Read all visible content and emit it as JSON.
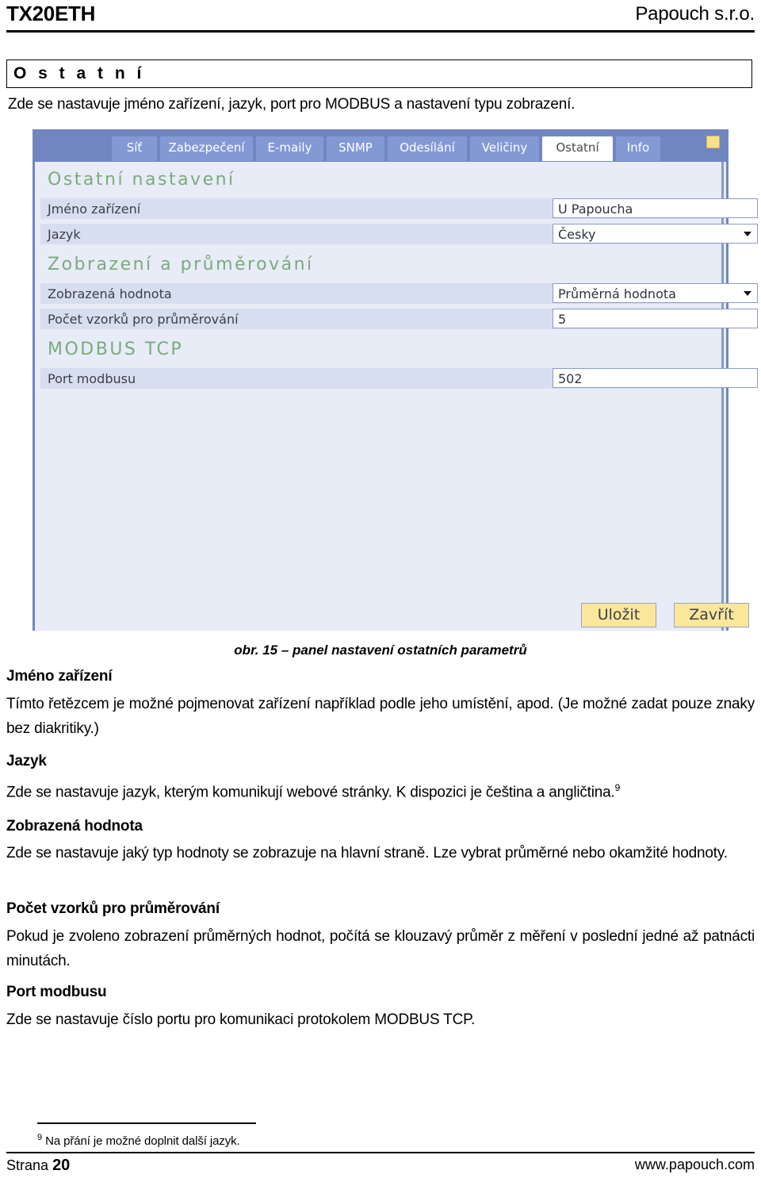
{
  "header": {
    "product": "TX20ETH",
    "company": "Papouch s.r.o."
  },
  "section": {
    "title": "O s t a t n í",
    "intro": "Zde se nastavuje jméno zařízení, jazyk, port pro MODBUS a nastavení typu zobrazení."
  },
  "screenshot": {
    "tabs": [
      {
        "label": "Síť",
        "active": false
      },
      {
        "label": "Zabezpečení",
        "active": false
      },
      {
        "label": "E-maily",
        "active": false
      },
      {
        "label": "SNMP",
        "active": false
      },
      {
        "label": "Odesílání",
        "active": false
      },
      {
        "label": "Veličiny",
        "active": false
      },
      {
        "label": "Ostatní",
        "active": true
      },
      {
        "label": "Info",
        "active": false
      }
    ],
    "groups": [
      {
        "heading": "Ostatní nastavení"
      },
      {
        "heading": "Zobrazení a průměrování"
      },
      {
        "heading": "MODBUS TCP"
      }
    ],
    "rows": [
      {
        "label": "Jméno zařízení",
        "value": "U Papoucha",
        "type": "text"
      },
      {
        "label": "Jazyk",
        "value": "Česky",
        "type": "select"
      },
      {
        "label": "Zobrazená hodnota",
        "value": "Průměrná hodnota",
        "type": "select"
      },
      {
        "label": "Počet vzorků pro průměrování",
        "value": "5",
        "type": "text"
      },
      {
        "label": "Port modbusu",
        "value": "502",
        "type": "text"
      }
    ],
    "buttons": {
      "save": "Uložit",
      "close": "Zavřít"
    },
    "colors": {
      "tabbar": "#7186c0",
      "tab": "#8399d4",
      "panel_bg": "#e8ecf7",
      "row_bg": "#d7deef",
      "group_heading": "#7aab7c",
      "button_bg": "#fbe79c",
      "marker": "#fbe08a"
    }
  },
  "figure": {
    "caption": "obr. 15 – panel nastavení ostatních parametrů"
  },
  "body_sections": [
    {
      "heading": "Jméno zařízení",
      "text": "Tímto řetězcem je možné pojmenovat zařízení například podle jeho umístění, apod. (Je možné zadat pouze znaky bez diakritiky.)"
    },
    {
      "heading": "Jazyk",
      "text": "Zde se nastavuje jazyk, kterým komunikují webové stránky. K dispozici je čeština a angličtina.",
      "footnote_ref": "9"
    },
    {
      "heading": "Zobrazená hodnota",
      "text": "Zde se nastavuje jaký typ hodnoty se zobrazuje na hlavní straně. Lze vybrat průměrné nebo okamžité hodnoty."
    },
    {
      "heading": "Počet vzorků pro průměrování",
      "text": "Pokud je zvoleno zobrazení průměrných hodnot, počítá se klouzavý průměr z měření v poslední jedné až patnácti minutách."
    },
    {
      "heading": "Port modbusu",
      "text": "Zde se nastavuje číslo portu pro komunikaci protokolem MODBUS TCP."
    }
  ],
  "footnote": {
    "marker": "9",
    "text": "Na přání je možné doplnit další jazyk."
  },
  "footer": {
    "page_label": "Strana",
    "page_number": "20",
    "website": "www.papouch.com"
  }
}
